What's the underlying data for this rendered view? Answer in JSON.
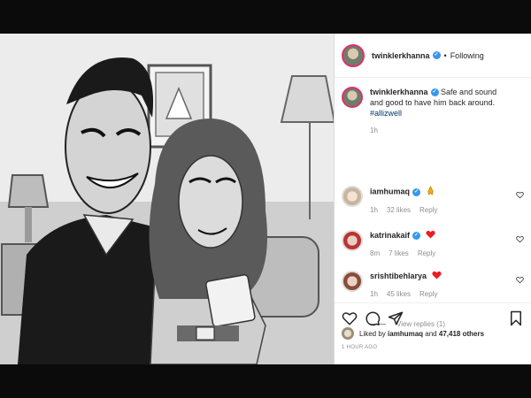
{
  "header": {
    "username": "twinklerkhanna",
    "following_label": "Following"
  },
  "caption": {
    "username": "twinklerkhanna",
    "text": "Safe and sound and good to have him back around.",
    "hashtag": "#allizwell",
    "time": "1h"
  },
  "comments": [
    {
      "username": "iamhumaq",
      "time": "1h",
      "likes": "32 likes",
      "reply_label": "Reply",
      "emoji": "pray"
    },
    {
      "username": "katrinakaif",
      "time": "8m",
      "likes": "7 likes",
      "reply_label": "Reply",
      "emoji": "red-heart"
    },
    {
      "username": "srishtibehlarya",
      "time": "1h",
      "likes": "45 likes",
      "reply_label": "Reply",
      "emoji": "red-heart"
    }
  ],
  "view_replies": "View replies (1)",
  "likes": {
    "prefix": "Liked by",
    "user": "iamhumaq",
    "conjunction": "and",
    "others": "47,418 others"
  },
  "time_ago": "1 HOUR AGO",
  "colors": {
    "verified": "#3897f0",
    "heart": "#ed4956",
    "link": "#00376b",
    "secondary_text": "#8e8e8e"
  }
}
